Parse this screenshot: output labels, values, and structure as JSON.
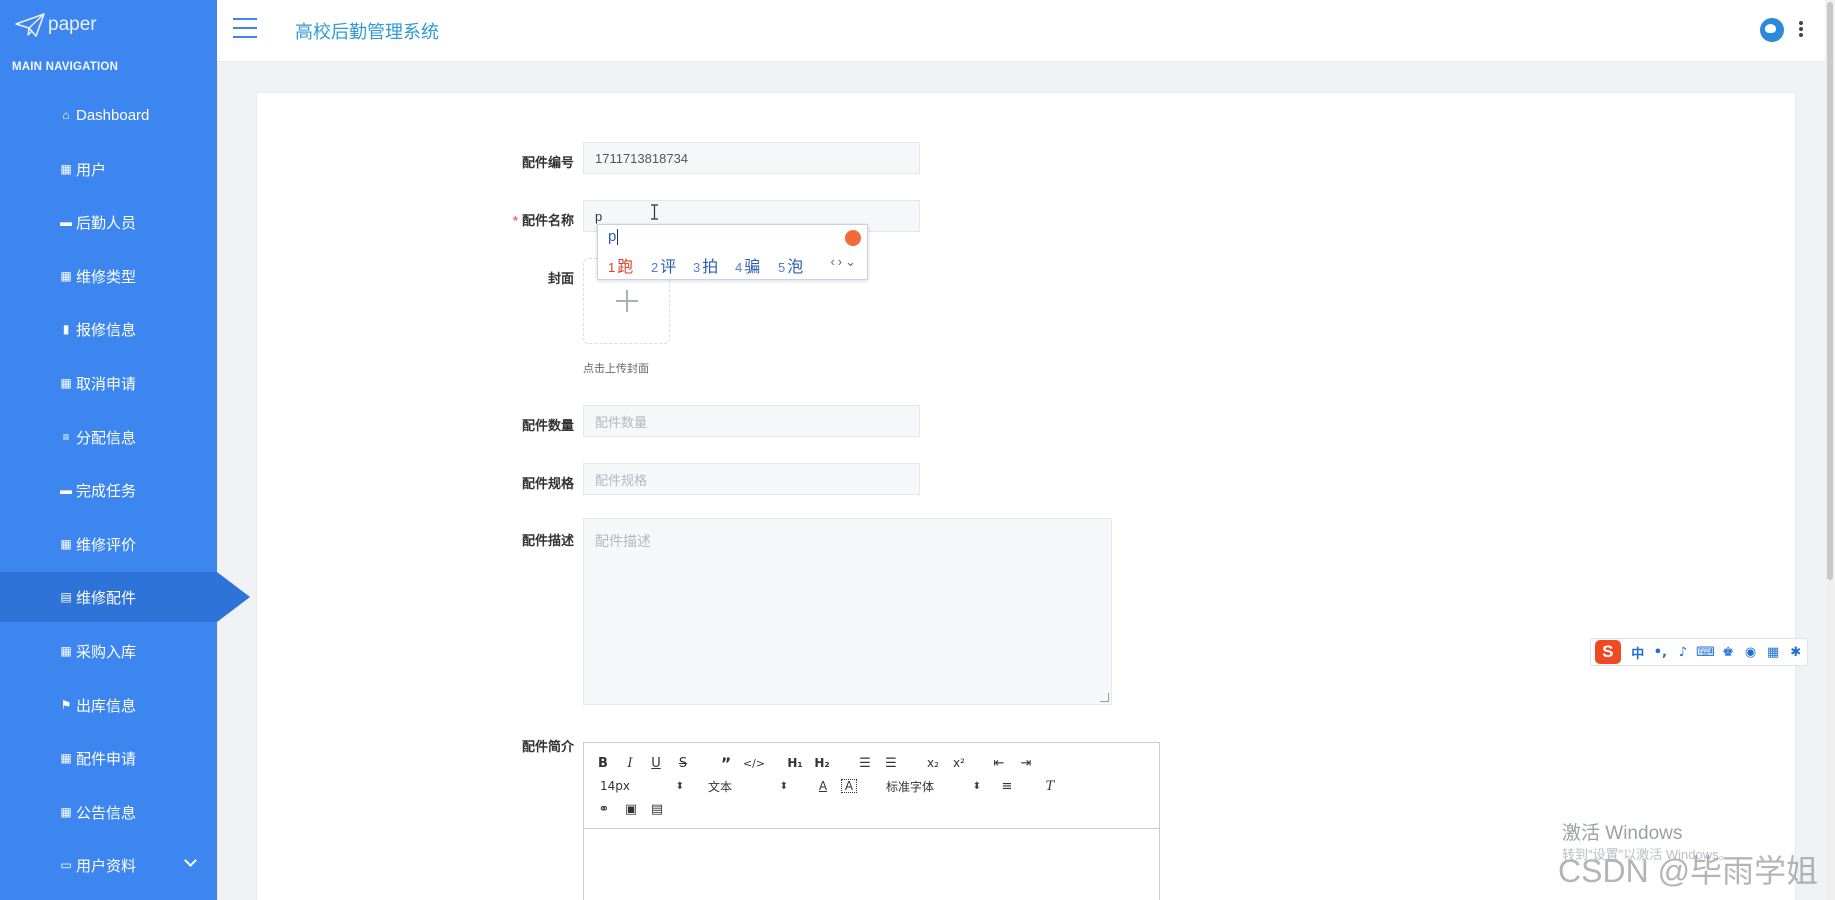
{
  "app": {
    "logo_text": "paper",
    "title": "高校后勤管理系统"
  },
  "sidebar": {
    "section_title": "MAIN NAVIGATION",
    "items": [
      {
        "icon": "home-icon",
        "glyph": "⌂",
        "label": "Dashboard"
      },
      {
        "icon": "grid-icon",
        "glyph": "▦",
        "label": "用户"
      },
      {
        "icon": "monitor-icon",
        "glyph": "▬",
        "label": "后勤人员"
      },
      {
        "icon": "grid-icon",
        "glyph": "▦",
        "label": "维修类型"
      },
      {
        "icon": "bar-chart-icon",
        "glyph": "▮",
        "label": "报修信息"
      },
      {
        "icon": "grid-icon",
        "glyph": "▦",
        "label": "取消申请"
      },
      {
        "icon": "list-icon",
        "glyph": "≡",
        "label": "分配信息"
      },
      {
        "icon": "comment-icon",
        "glyph": "▬",
        "label": "完成任务"
      },
      {
        "icon": "table-icon",
        "glyph": "▦",
        "label": "维修评价"
      },
      {
        "icon": "clipboard-icon",
        "glyph": "▤",
        "label": "维修配件",
        "active": true
      },
      {
        "icon": "grid-icon",
        "glyph": "▦",
        "label": "采购入库"
      },
      {
        "icon": "flag-icon",
        "glyph": "⚑",
        "label": "出库信息"
      },
      {
        "icon": "grid-icon",
        "glyph": "▦",
        "label": "配件申请"
      },
      {
        "icon": "grid-icon",
        "glyph": "▦",
        "label": "公告信息"
      },
      {
        "icon": "folder-icon",
        "glyph": "▭",
        "label": "用户资料",
        "expandable": true
      }
    ]
  },
  "form": {
    "part_no": {
      "label": "配件编号",
      "value": "1711713818734"
    },
    "part_name": {
      "label": "配件名称",
      "required_mark": "*",
      "value": "p"
    },
    "cover": {
      "label": "封面",
      "hint": "点击上传封面"
    },
    "quantity": {
      "label": "配件数量",
      "placeholder": "配件数量"
    },
    "spec": {
      "label": "配件规格",
      "placeholder": "配件规格"
    },
    "description": {
      "label": "配件描述",
      "placeholder": "配件描述"
    },
    "intro": {
      "label": "配件简介"
    }
  },
  "editor": {
    "font_size": "14px",
    "paragraph": "文本",
    "font_family": "标准字体"
  },
  "ime": {
    "input": "p",
    "candidates": [
      {
        "num": "1",
        "text": "跑"
      },
      {
        "num": "2",
        "text": "评"
      },
      {
        "num": "3",
        "text": "拍"
      },
      {
        "num": "4",
        "text": "骗"
      },
      {
        "num": "5",
        "text": "泡"
      }
    ]
  },
  "sogou_toolbar": {
    "logo": "S",
    "mode": "中",
    "punct": "•,"
  },
  "watermarks": {
    "windows": "激活 Windows",
    "windows_sub": "转到\"设置\"以激活 Windows。",
    "csdn": "CSDN @毕雨学姐"
  }
}
